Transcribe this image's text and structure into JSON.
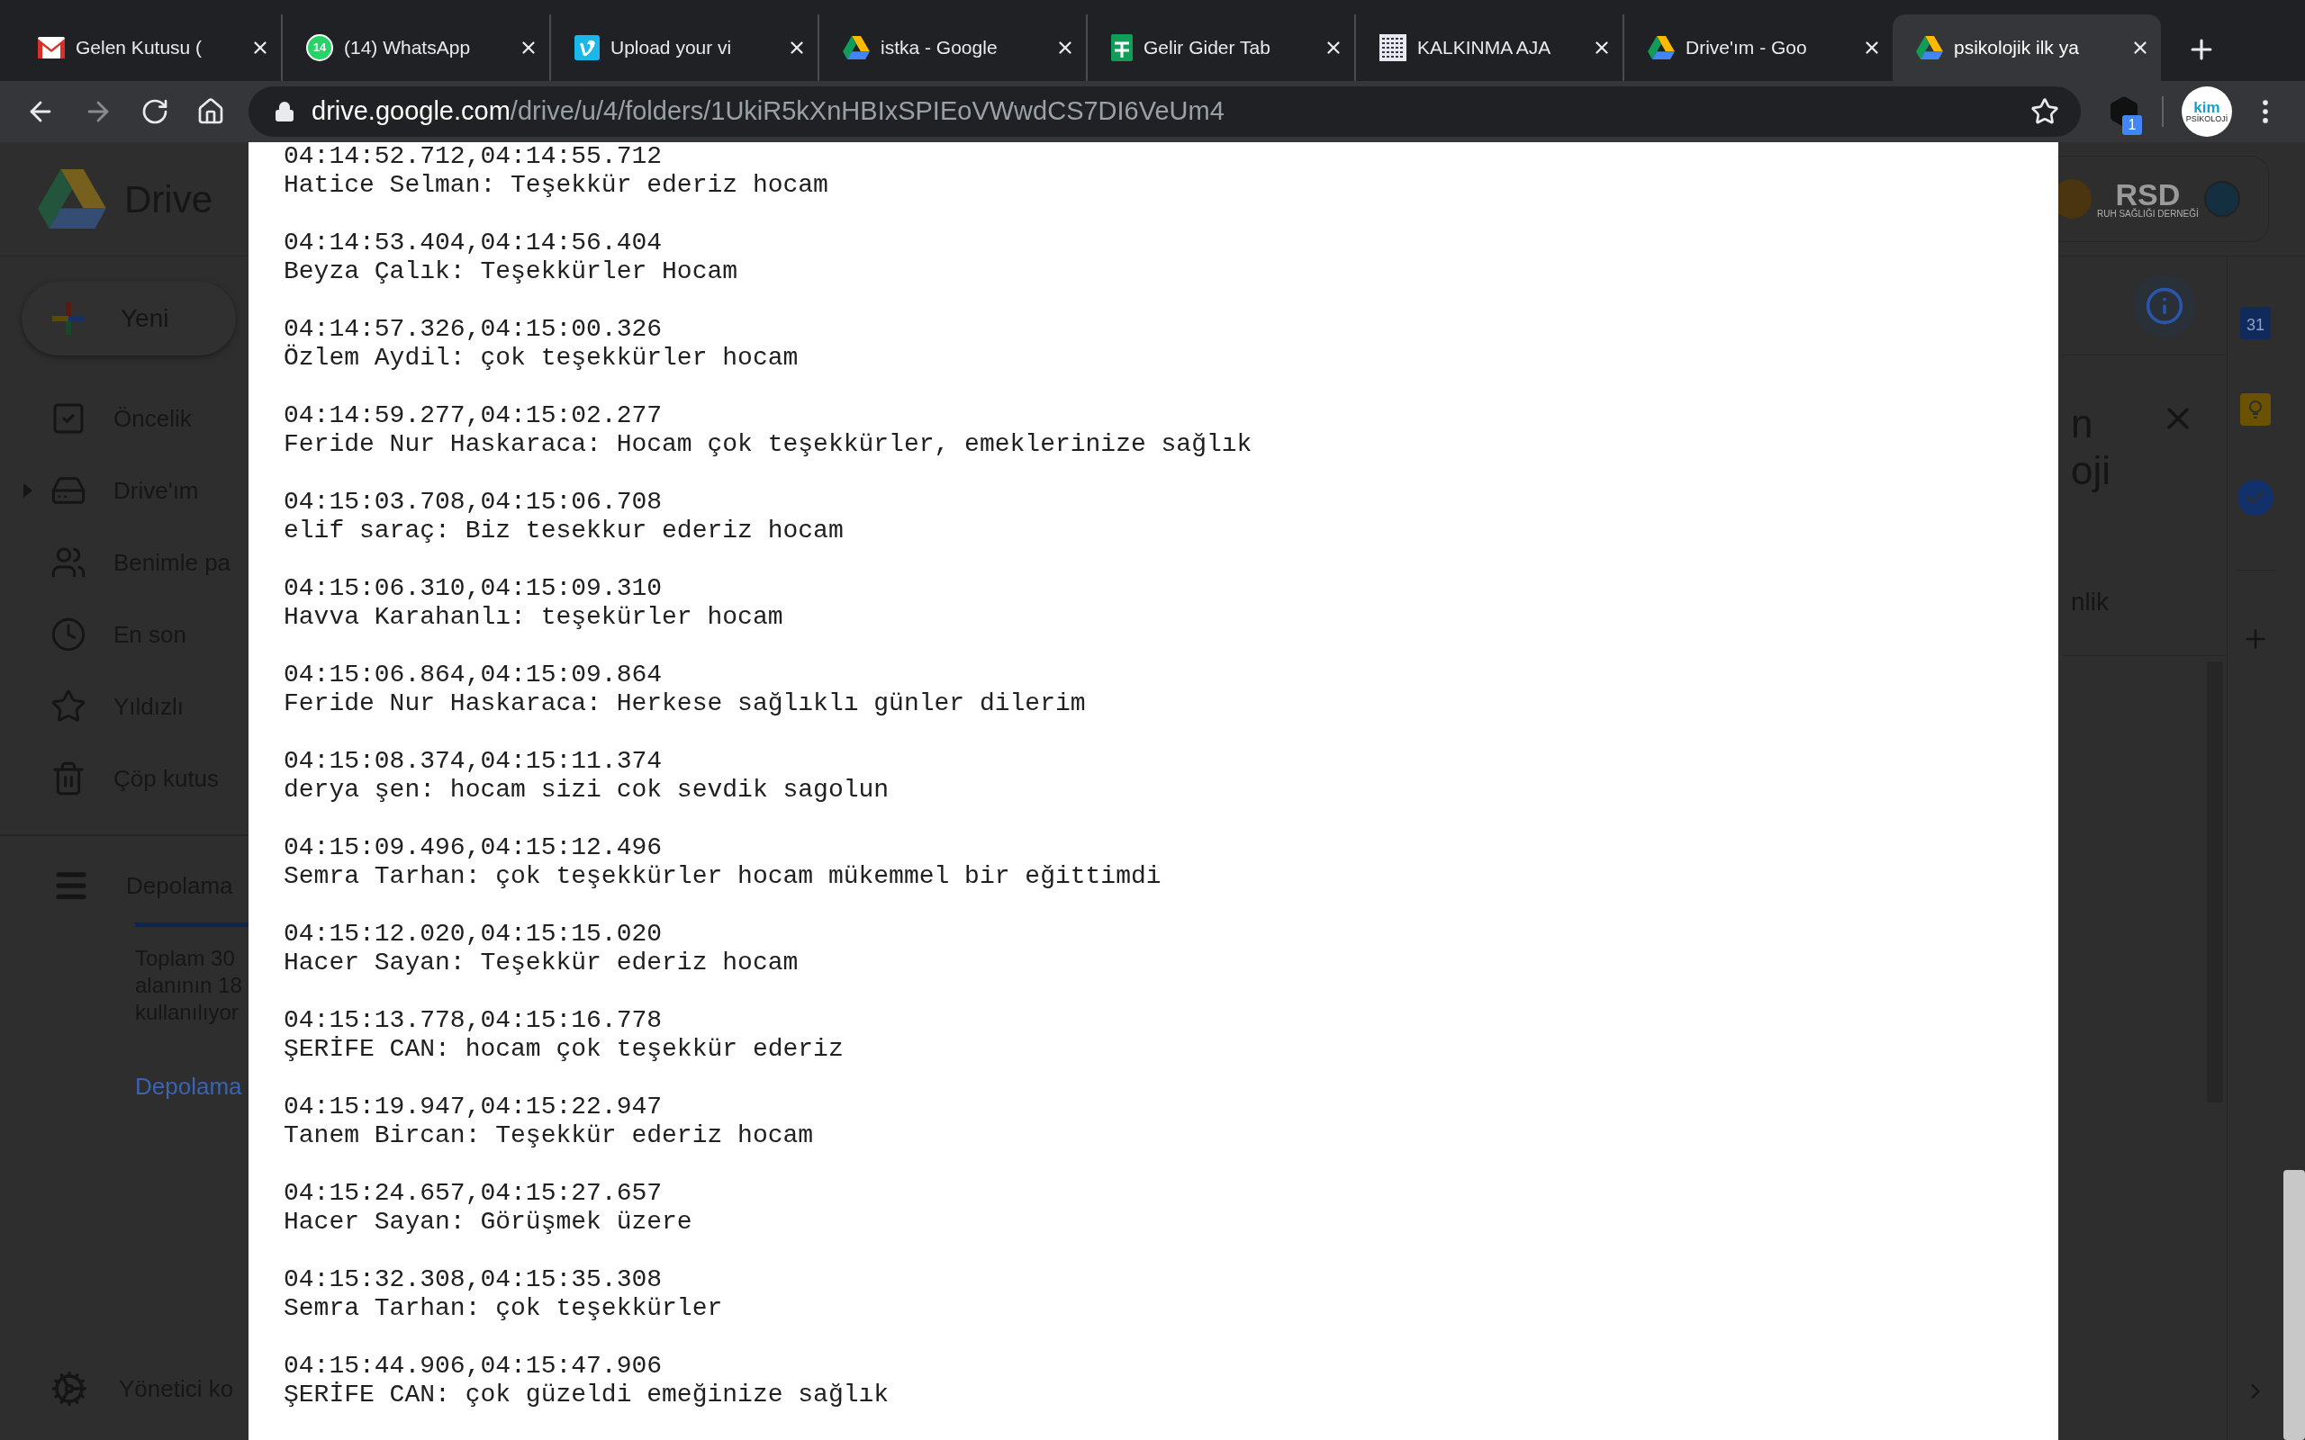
{
  "browser": {
    "tabs": [
      {
        "title": "Gelen Kutusu (",
        "kind": "mail",
        "selected": false
      },
      {
        "title": "(14) WhatsApp",
        "kind": "chat",
        "badge": "14",
        "selected": false
      },
      {
        "title": "Upload your vi",
        "kind": "video",
        "selected": false
      },
      {
        "title": "istka - Google",
        "kind": "drive",
        "selected": false
      },
      {
        "title": "Gelir Gider Tab",
        "kind": "sheet",
        "selected": false
      },
      {
        "title": "KALKINMA AJA",
        "kind": "image",
        "selected": false
      },
      {
        "title": "Drive'ım - Goo",
        "kind": "drive",
        "selected": false
      },
      {
        "title": "psikolojik ilk ya",
        "kind": "drive",
        "selected": true
      }
    ],
    "url_host": "drive.google.com",
    "url_path": "/drive/u/4/folders/1UkiR5kXnHBIxSPIEoVWwdCS7DI6VeUm4",
    "extension_badge": "1",
    "profile": {
      "text": "kim",
      "subtext": "PSİKOLOJİ"
    }
  },
  "drive": {
    "logo_text": "Drive",
    "new_button": "Yeni",
    "nav": [
      {
        "label": "Öncelik",
        "kind": "priority",
        "expandable": false
      },
      {
        "label": "Drive'ım",
        "kind": "drive",
        "expandable": true
      },
      {
        "label": "Benimle pa",
        "kind": "shared",
        "expandable": false
      },
      {
        "label": "En son",
        "kind": "recent",
        "expandable": false
      },
      {
        "label": "Yıldızlı",
        "kind": "starred",
        "expandable": false
      },
      {
        "label": "Çöp kutus",
        "kind": "trash",
        "expandable": false
      }
    ],
    "storage": {
      "title": "Depolama",
      "lines": [
        "Toplam 30",
        "alanının 18",
        "kullanılıyor"
      ],
      "link": "Depolama"
    },
    "admin": "Yönetici ko",
    "brand": {
      "title": "RSD",
      "subtitle": "RUH SAĞLIĞI DERNEĞİ"
    },
    "details_title": [
      "n",
      "oji"
    ],
    "details_tab": "nlik",
    "side_apps": [
      {
        "kind": "calendar",
        "text": "31"
      },
      {
        "kind": "keep"
      },
      {
        "kind": "tasks"
      }
    ]
  },
  "transcript": [
    {
      "time": "04:14:52.712,04:14:55.712",
      "line": "Hatice Selman: Teşekkür ederiz hocam"
    },
    {
      "time": "04:14:53.404,04:14:56.404",
      "line": "Beyza Çalık: Teşekkürler Hocam"
    },
    {
      "time": "04:14:57.326,04:15:00.326",
      "line": "Özlem Aydil: çok teşekkürler hocam"
    },
    {
      "time": "04:14:59.277,04:15:02.277",
      "line": "Feride Nur Haskaraca: Hocam çok teşekkürler, emeklerinize sağlık"
    },
    {
      "time": "04:15:03.708,04:15:06.708",
      "line": "elif saraç: Biz tesekkur ederiz hocam"
    },
    {
      "time": "04:15:06.310,04:15:09.310",
      "line": "Havva Karahanlı: teşekürler hocam"
    },
    {
      "time": "04:15:06.864,04:15:09.864",
      "line": "Feride Nur Haskaraca: Herkese sağlıklı günler dilerim"
    },
    {
      "time": "04:15:08.374,04:15:11.374",
      "line": "derya şen: hocam sizi cok sevdik sagolun"
    },
    {
      "time": "04:15:09.496,04:15:12.496",
      "line": "Semra Tarhan: çok teşekkürler hocam mükemmel bir eğittimdi"
    },
    {
      "time": "04:15:12.020,04:15:15.020",
      "line": "Hacer Sayan: Teşekkür ederiz hocam"
    },
    {
      "time": "04:15:13.778,04:15:16.778",
      "line": "ŞERİFE CAN: hocam çok teşekkür ederiz"
    },
    {
      "time": "04:15:19.947,04:15:22.947",
      "line": "Tanem Bircan: Teşekkür ederiz hocam"
    },
    {
      "time": "04:15:24.657,04:15:27.657",
      "line": "Hacer Sayan: Görüşmek üzere"
    },
    {
      "time": "04:15:32.308,04:15:35.308",
      "line": "Semra Tarhan: çok teşekkürler"
    },
    {
      "time": "04:15:44.906,04:15:47.906",
      "line": "ŞERİFE CAN: çok güzeldi emeğinize sağlık"
    }
  ]
}
